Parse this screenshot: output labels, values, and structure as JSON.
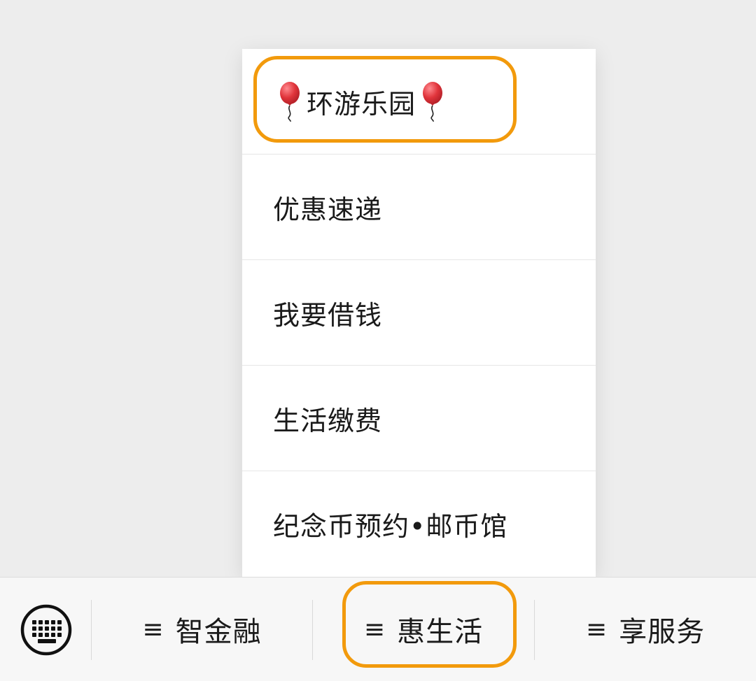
{
  "popup_menu": {
    "items": [
      {
        "label": "环游乐园",
        "decorations": [
          "balloon-icon",
          "balloon-icon"
        ]
      },
      {
        "label": "优惠速递"
      },
      {
        "label": "我要借钱"
      },
      {
        "label": "生活缴费"
      },
      {
        "label": "纪念币预约•邮币馆"
      }
    ]
  },
  "bottom_bar": {
    "keyboard_icon": "keyboard-icon",
    "menu_icon_glyph": "≡",
    "tabs": [
      {
        "label": "智金融"
      },
      {
        "label": "惠生活",
        "highlighted": true
      },
      {
        "label": "享服务"
      }
    ]
  },
  "colors": {
    "highlight_ring": "#f29a0c",
    "balloon": "#e0343b",
    "background": "#ededed",
    "popup_bg": "#ffffff"
  }
}
